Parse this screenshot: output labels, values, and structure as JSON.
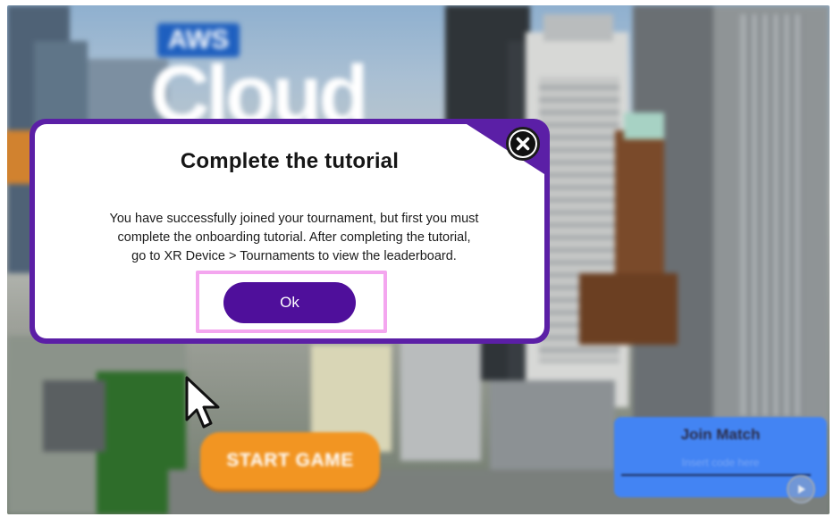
{
  "modal": {
    "title": "Complete the tutorial",
    "body_lines": [
      "You have successfully joined your tournament, but first you must",
      "complete the onboarding tutorial. After completing the tutorial,",
      "go to XR Device > Tournaments to view the leaderboard."
    ],
    "ok_label": "Ok",
    "close_icon": "close-x-icon"
  },
  "scene": {
    "aws_logo_text": "AWS",
    "cloud_logo_text": "Cloud"
  },
  "controls": {
    "start_label": "START GAME",
    "join_title": "Join Match",
    "join_placeholder": "Insert code here"
  },
  "colors": {
    "modal_border": "#5b1fa6",
    "ok_button": "#4f0f9b",
    "highlight": "#f4a6ef",
    "start_button": "#f29522",
    "join_panel": "#4384f3"
  }
}
